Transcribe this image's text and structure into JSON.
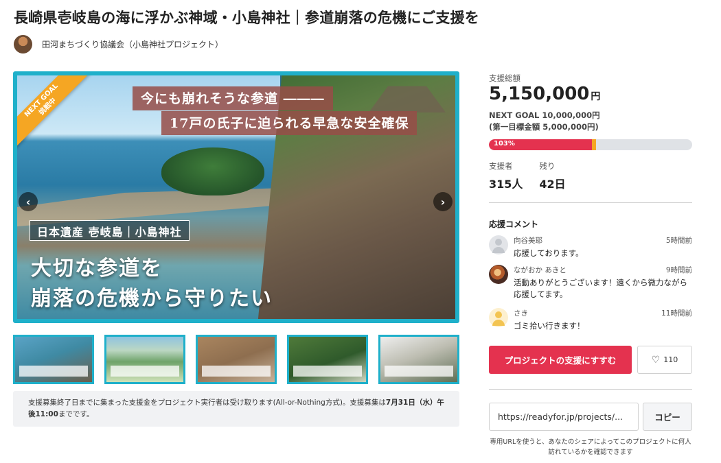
{
  "project": {
    "title": "長崎県壱岐島の海に浮かぶ神域・小島神社｜参道崩落の危機にご支援を",
    "owner": "田河まちづくり協議会（小島神社プロジェクト）"
  },
  "hero": {
    "ribbon_line1": "NEXT GOAL",
    "ribbon_line2": "挑戦中",
    "band1": "今にも崩れそうな参道 ―――",
    "band2": "17戸の氏子に迫られる早急な安全確保",
    "tagline": "日本遺産 壱岐島｜小島神社",
    "headline1": "大切な参道を",
    "headline2": "崩落の危機から守りたい",
    "prev_icon": "chevron-left-icon",
    "next_icon": "chevron-right-icon"
  },
  "notice": {
    "text_before": "支援募集終了日までに集まった支援金をプロジェクト実行者は受け取ります(All-or-Nothing方式)。支援募集は",
    "deadline": "7月31日（水）午後11:00",
    "text_after": "までです。"
  },
  "funding": {
    "total_label": "支援総額",
    "total_amount": "5,150,000",
    "currency": "円",
    "next_goal": "NEXT GOAL 10,000,000円",
    "first_goal": "(第一目標金額 5,000,000円)",
    "progress_label": "103%",
    "progress_fraction": 0.515,
    "supporters_label": "支援者",
    "supporters_value": "315人",
    "remaining_label": "残り",
    "remaining_value": "42日"
  },
  "comments": {
    "title": "応援コメント",
    "items": [
      {
        "name": "向谷美耶",
        "time": "5時間前",
        "text": "応援しております。"
      },
      {
        "name": "ながおか あきと",
        "time": "9時間前",
        "text": "活動ありがとうございます！遠くから微力ながら応援してます。"
      },
      {
        "name": "さき",
        "time": "11時間前",
        "text": "ゴミ拾い行きます！"
      }
    ]
  },
  "actions": {
    "support_label": "プロジェクトの支援にすすむ",
    "favorite_count": "110",
    "favorite_icon": "heart-icon"
  },
  "share": {
    "url": "https://readyfor.jp/projects/...",
    "copy_label": "コピー",
    "note": "専用URLを使うと、あなたのシェアによってこのプロジェクトに何人訪れているかを確認できます"
  },
  "colors": {
    "accent": "#e4324f",
    "hero_border": "#1fb0ca",
    "ribbon": "#f5a623"
  }
}
